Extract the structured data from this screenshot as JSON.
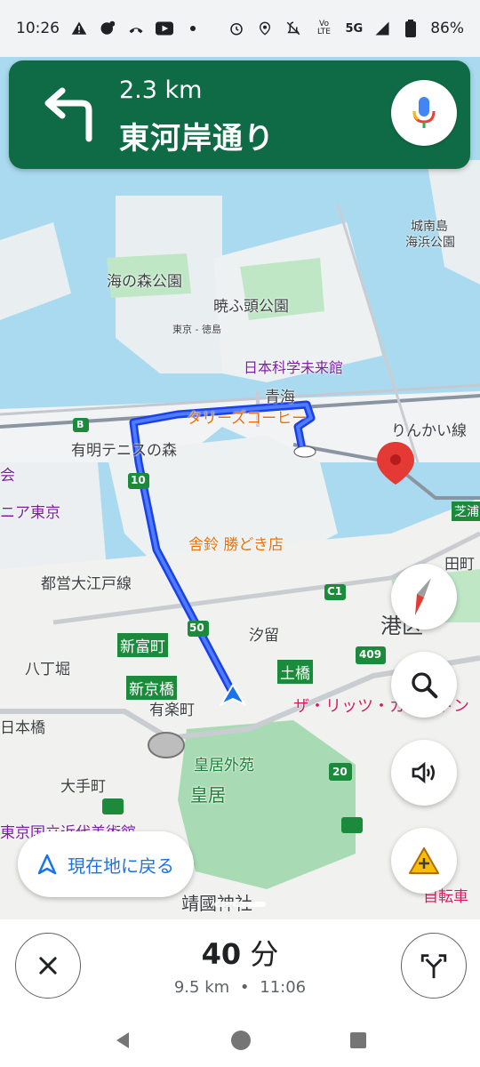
{
  "status_bar": {
    "time": "10:26",
    "battery": "86%",
    "network": "5G"
  },
  "navigation": {
    "distance": "2.3 km",
    "street": "東河岸通り"
  },
  "map": {
    "labels": {
      "umi_no_mori": "海の森公園",
      "akatsuki": "暁ふ頭公園",
      "miraikan": "日本科学未来館",
      "aomi": "青海",
      "rinkai": "りんかい線",
      "tullys": "タリーズコーヒー",
      "ariake_tennis": "有明テニスの森",
      "kachidoki_shop": "舎鈴 勝どき店",
      "toei_oedo": "都営大江戸線",
      "shintomicho": "新富町",
      "hatchobori": "八丁堀",
      "shinkyobashi": "新京橋",
      "yurakucho": "有楽町",
      "nihonbashi": "日本橋",
      "otemachi": "大手町",
      "kokyo_gaien": "皇居外苑",
      "kokyo": "皇居",
      "shiodome": "汐留",
      "dobashi": "土橋",
      "minato": "港区",
      "ritz": "ザ・リッツ・カールトン",
      "yasukuni": "靖國神社",
      "kokuritsu": "東京国立近代美術館",
      "shibaura": "芝浦",
      "jonan": "城南島",
      "jonan_park": "海浜公園",
      "tokyo_tokushima": "東京 - 徳島",
      "kai": "会",
      "nia_tokyo": "ニア東京",
      "route_50": "50",
      "route_10": "10",
      "route_409": "409",
      "route_20": "20",
      "route_c1": "C1",
      "route_b": "B",
      "jitensha": "自転車",
      "tamachi": "田町"
    }
  },
  "controls": {
    "recenter_label": "現在地に戻る"
  },
  "trip": {
    "eta_minutes": "40",
    "eta_unit": "分",
    "distance": "9.5 km",
    "separator": "•",
    "arrival": "11:06"
  },
  "colors": {
    "banner": "#0f6b45",
    "route": "#1a40e8",
    "accent": "#1a73e8"
  }
}
